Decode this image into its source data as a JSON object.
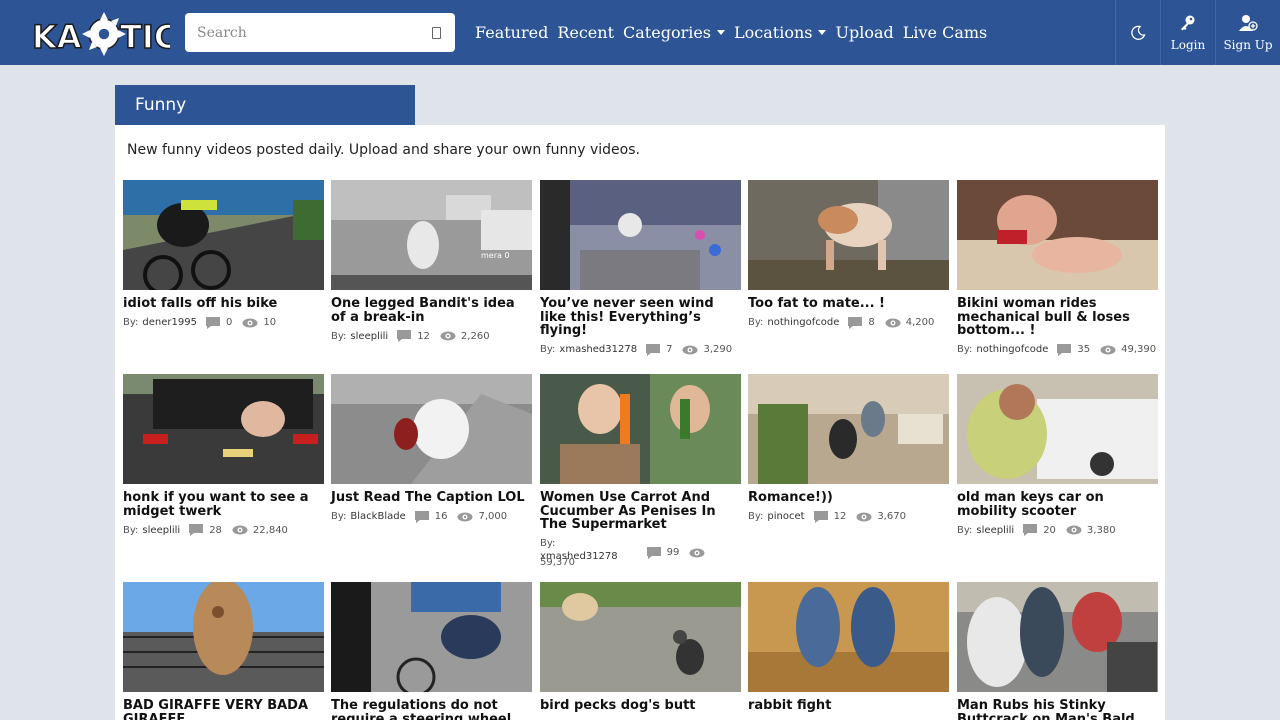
{
  "header": {
    "logo_text": "KAOTIC",
    "search_placeholder": "Search",
    "nav": [
      {
        "label": "Featured"
      },
      {
        "label": "Recent"
      },
      {
        "label": "Categories"
      },
      {
        "label": "Locations"
      },
      {
        "label": "Upload"
      },
      {
        "label": "Live Cams"
      }
    ],
    "login_label": "Login",
    "signup_label": "Sign Up"
  },
  "category": {
    "title": "Funny",
    "description": "New funny videos posted daily. Upload and share your own funny videos."
  },
  "by_label": "By:",
  "videos": [
    {
      "title": "idiot falls off his bike",
      "author": "dener1995",
      "comments": "0",
      "views": "10"
    },
    {
      "title": "One legged Bandit's idea of a break-in",
      "author": "sleeplili",
      "comments": "12",
      "views": "2,260"
    },
    {
      "title": "You’ve never seen wind like this! Everything’s flying!",
      "author": "xmashed31278",
      "comments": "7",
      "views": "3,290"
    },
    {
      "title": "Too fat to mate... !",
      "author": "nothingofcode",
      "comments": "8",
      "views": "4,200"
    },
    {
      "title": "Bikini woman rides mechanical bull & loses bottom... !",
      "author": "nothingofcode",
      "comments": "35",
      "views": "49,390"
    },
    {
      "title": "honk if you want to see a midget twerk",
      "author": "sleeplili",
      "comments": "28",
      "views": "22,840"
    },
    {
      "title": "Just Read The Caption LOL",
      "author": "BlackBlade",
      "comments": "16",
      "views": "7,000"
    },
    {
      "title": "Women Use Carrot And Cucumber As Penises In The Supermarket",
      "author": "xmashed31278",
      "comments": "99",
      "views": "59,370"
    },
    {
      "title": "Romance!))",
      "author": "pinocet",
      "comments": "12",
      "views": "3,670"
    },
    {
      "title": "old man keys car on mobility scooter",
      "author": "sleeplili",
      "comments": "20",
      "views": "3,380"
    },
    {
      "title": "BAD GIRAFFE VERY BADA GIRAFFE",
      "author": "",
      "comments": "",
      "views": ""
    },
    {
      "title": "The regulations do not require a steering wheel",
      "author": "",
      "comments": "",
      "views": ""
    },
    {
      "title": "bird pecks dog's butt",
      "author": "",
      "comments": "",
      "views": ""
    },
    {
      "title": "rabbit fight",
      "author": "",
      "comments": "",
      "views": ""
    },
    {
      "title": "Man Rubs his Stinky Buttcrack on Man's Bald",
      "author": "",
      "comments": "",
      "views": ""
    }
  ],
  "colors": {
    "header_bg": "#2d5596",
    "page_bg": "#dfe3ea",
    "panel_bg": "#ffffff"
  }
}
